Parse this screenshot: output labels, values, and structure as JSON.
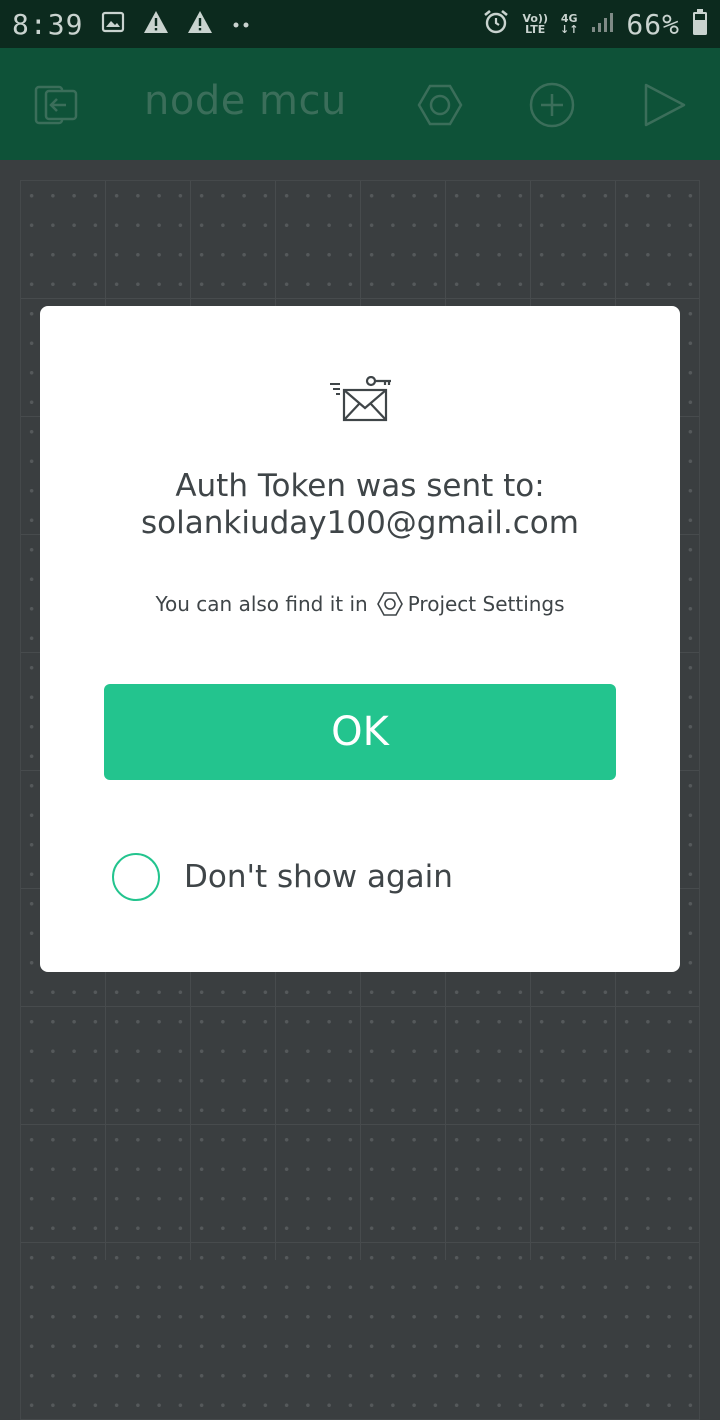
{
  "status_bar": {
    "time": "8:39",
    "volte_line1": "Vo))",
    "volte_line2": "LTE",
    "network_type": "4G",
    "battery_percent": "66%",
    "icons": [
      "image-icon",
      "warning-icon",
      "warning-icon",
      "more-dots-icon",
      "alarm-icon",
      "signal-icon",
      "battery-icon"
    ]
  },
  "app_bar": {
    "title": "node mcu",
    "icons": [
      "exit-icon",
      "settings-icon",
      "add-icon",
      "play-icon"
    ]
  },
  "dialog": {
    "icon": "email-key-icon",
    "title_line1": "Auth Token was sent to:",
    "title_line2": "solankiuday100@gmail.com",
    "hint_prefix": "You can also find it in",
    "hint_link": "Project Settings",
    "ok_label": "OK",
    "dont_show_label": "Don't show again",
    "dont_show_checked": false
  },
  "colors": {
    "status_bar_bg": "#0c2a1e",
    "app_bar_bg": "#0e5238",
    "accent": "#23c48e",
    "canvas_bg": "#3a3e40",
    "dialog_text": "#3f4548"
  }
}
